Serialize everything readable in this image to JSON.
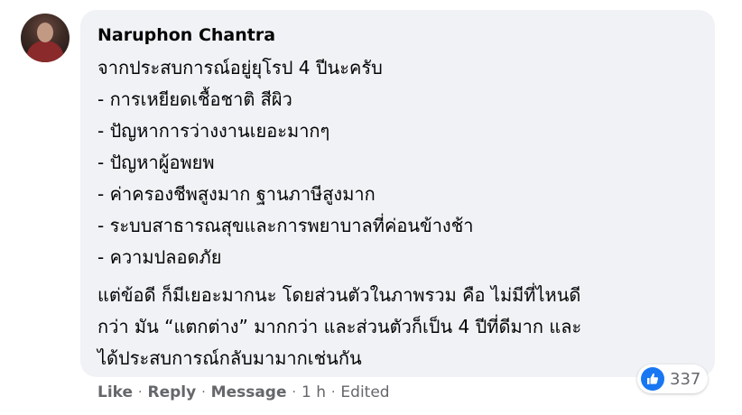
{
  "comment": {
    "author": "Naruphon Chantra",
    "lines": [
      "จากประสบการณ์อยู่ยุโรป 4 ปีนะครับ",
      "- การเหยียดเชื้อชาติ สีผิว",
      "- ปัญหาการว่างงานเยอะมากๆ",
      "- ปัญหาผู้อพยพ",
      "- ค่าครองชีพสูงมาก ฐานภาษีสูงมาก",
      "- ระบบสาธารณสุขและการพยาบาลที่ค่อนข้างช้า",
      "- ความปลอดภัย",
      "แต่ข้อดี ก็มีเยอะมากนะ โดยส่วนตัวในภาพรวม คือ ไม่มีที่ไหนดี",
      "กว่า มัน “แตกต่าง” มากกว่า และส่วนตัวก็เป็น 4 ปีที่ดีมาก และ",
      "ได้ประสบการณ์กลับมามากเช่นกัน"
    ],
    "reactions": {
      "count": "337",
      "icon": "like-thumb-icon",
      "color": "#1877f2"
    }
  },
  "actions": {
    "like": "Like",
    "reply": "Reply",
    "message": "Message",
    "separator": "·",
    "time": "1 h",
    "edited": "Edited"
  }
}
